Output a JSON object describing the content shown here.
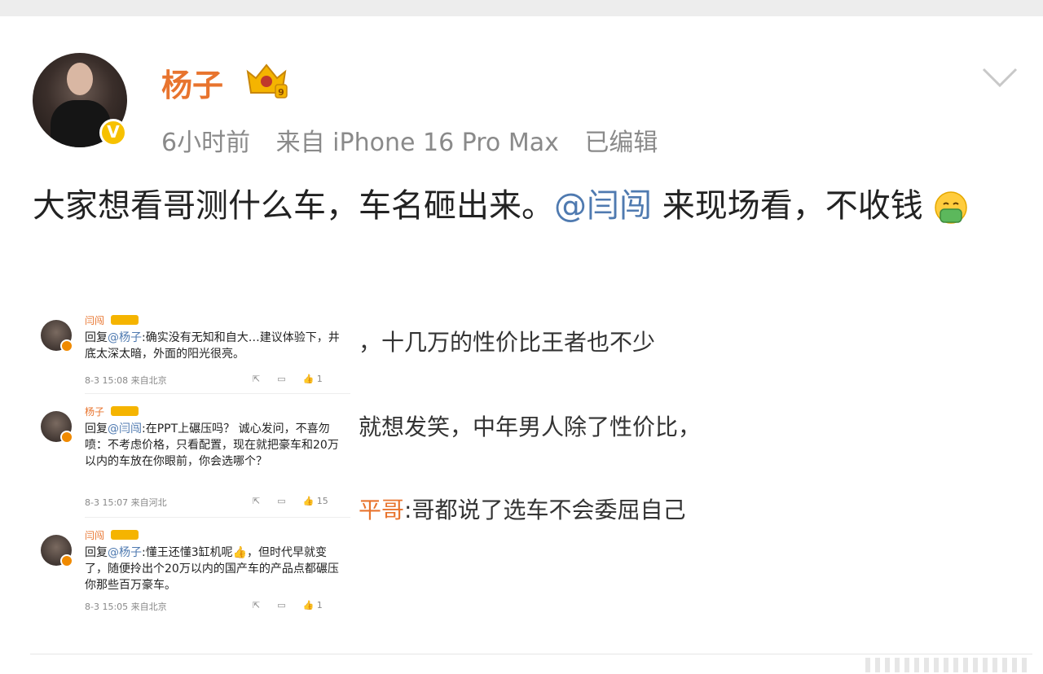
{
  "post": {
    "author": "杨子",
    "time": "6小时前",
    "source": "来自 iPhone 16 Pro Max",
    "edited": "已编辑",
    "text_before": "大家想看哥测什么车，车名砸出来。",
    "mention": "@闫闯",
    "text_after": " 来现场看，不收钱",
    "emoji": "smiling-face-with-hands-emoji",
    "verified_badge": "V"
  },
  "embedded": {
    "background_lines": [
      "，十几万的性价比王者也不少",
      "就想发笑，中年男人除了性价比，",
      "平哥",
      ":哥都说了选车不会委屈自己"
    ],
    "replies": [
      {
        "name": "闫闯",
        "level": "II",
        "prefix": "回复",
        "mention": "@杨子",
        "text": ":确实没有无知和自大…建议体验下，井底太深太暗，外面的阳光很亮。",
        "date": "8-3 15:08",
        "location": "来自北京",
        "likes": "1"
      },
      {
        "name": "杨子",
        "level": "9",
        "prefix": "回复",
        "mention": "@闫闯",
        "text": ":在PPT上碾压吗？ 诚心发问，不喜勿喷：不考虑价格，只看配置，现在就把豪车和20万以内的车放在你眼前，你会选哪个？",
        "date": "8-3 15:07",
        "location": "来自河北",
        "likes": "15"
      },
      {
        "name": "闫闯",
        "level": "II",
        "prefix": "回复",
        "mention": "@杨子",
        "text": ":懂王还懂3缸机呢👍，但时代早就变了，随便拎出个20万以内的国产车的产品点都碾压你那些百万豪车。",
        "date": "8-3 15:05",
        "location": "来自北京",
        "likes": "1"
      }
    ]
  },
  "colors": {
    "username": "#e8742e",
    "mention": "#4f7ab0",
    "meta": "#8a8a8a",
    "badge": "#f7c100"
  }
}
